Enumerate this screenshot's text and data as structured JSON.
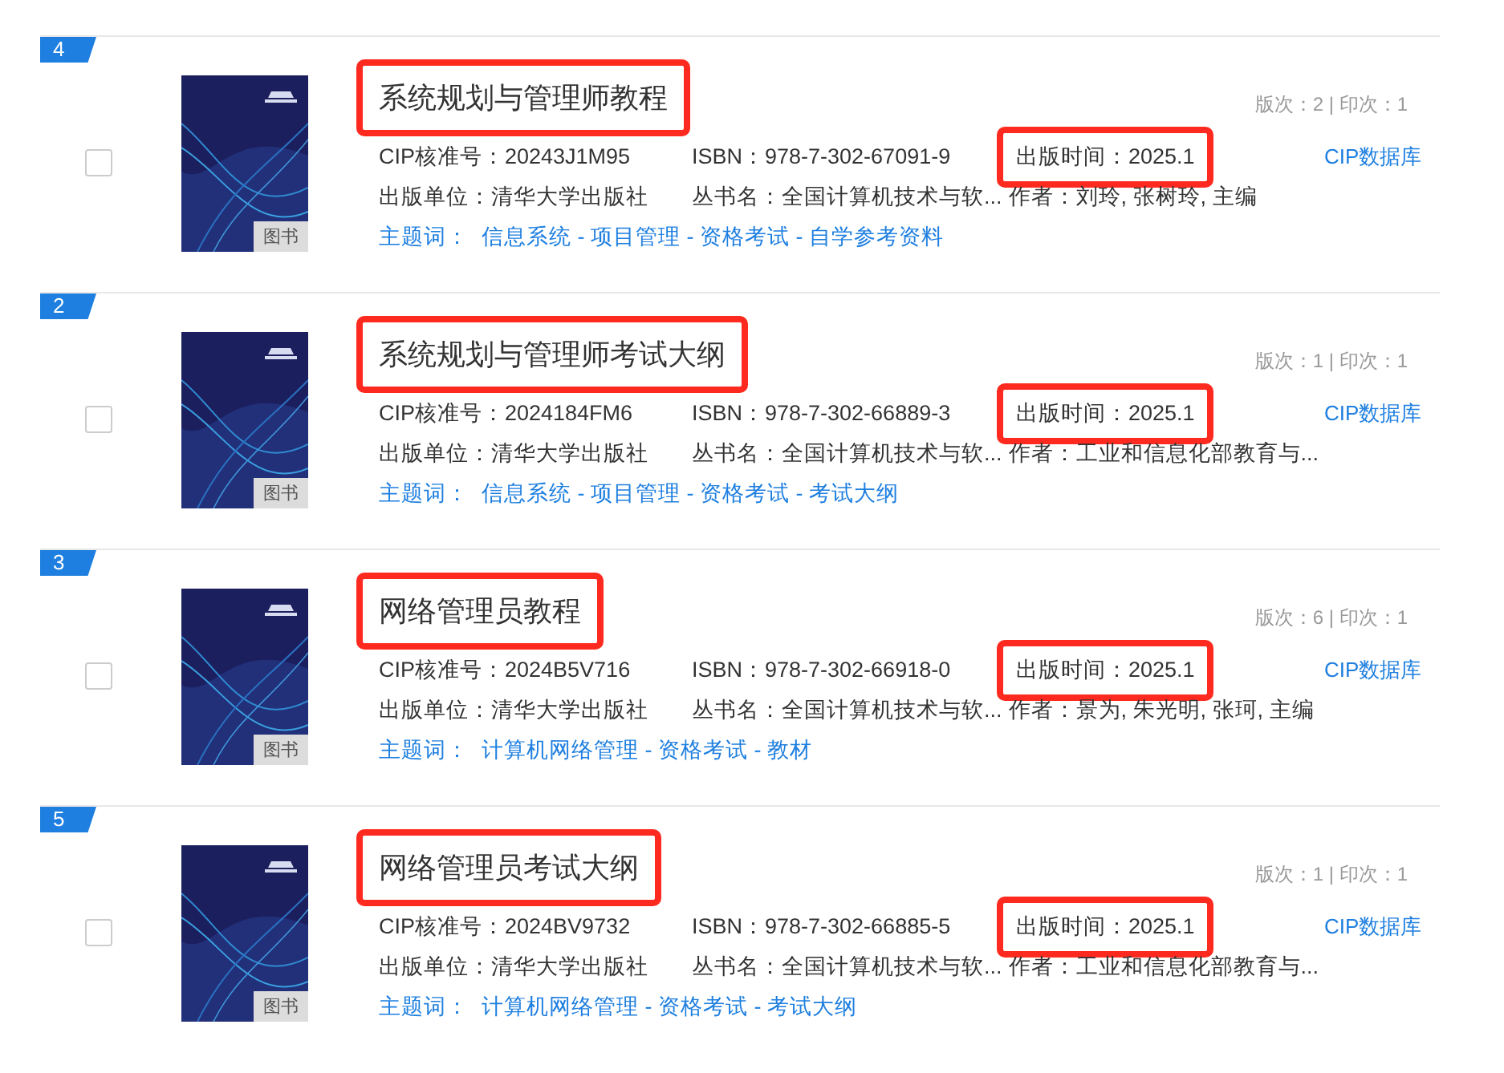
{
  "results": [
    {
      "rank": "4",
      "checked": false,
      "badge": "图书",
      "title": {
        "text": "系统规划与管理师教程",
        "highlighted": true
      },
      "edition": "版次：2 | 印次：1",
      "cip": "CIP核准号：20243J1M95",
      "isbn": "ISBN：978-7-302-67091-9",
      "pub_date": {
        "text": "出版时间：2025.1",
        "highlighted": true
      },
      "database_link": "CIP数据库",
      "publisher": "出版单位：清华大学出版社",
      "series": "丛书名：全国计算机技术与软...",
      "author": "作者：刘玲, 张树玲, 主编",
      "subject_label": "主题词：",
      "subjects": "信息系统 - 项目管理 - 资格考试 - 自学参考资料"
    },
    {
      "rank": "2",
      "checked": false,
      "badge": "图书",
      "title": {
        "text": "系统规划与管理师考试大纲",
        "highlighted": true
      },
      "edition": "版次：1 | 印次：1",
      "cip": "CIP核准号：2024184FM6",
      "isbn": "ISBN：978-7-302-66889-3",
      "pub_date": {
        "text": "出版时间：2025.1",
        "highlighted": true
      },
      "database_link": "CIP数据库",
      "publisher": "出版单位：清华大学出版社",
      "series": "丛书名：全国计算机技术与软...",
      "author": "作者：工业和信息化部教育与...",
      "subject_label": "主题词：",
      "subjects": "信息系统 - 项目管理 - 资格考试 - 考试大纲"
    },
    {
      "rank": "3",
      "checked": false,
      "badge": "图书",
      "title": {
        "text": "网络管理员教程",
        "highlighted": true
      },
      "edition": "版次：6 | 印次：1",
      "cip": "CIP核准号：2024B5V716",
      "isbn": "ISBN：978-7-302-66918-0",
      "pub_date": {
        "text": "出版时间：2025.1",
        "highlighted": true
      },
      "database_link": "CIP数据库",
      "publisher": "出版单位：清华大学出版社",
      "series": "丛书名：全国计算机技术与软...",
      "author": "作者：景为, 朱光明, 张珂, 主编",
      "subject_label": "主题词：",
      "subjects": "计算机网络管理 - 资格考试 - 教材"
    },
    {
      "rank": "5",
      "checked": false,
      "badge": "图书",
      "title": {
        "text": "网络管理员考试大纲",
        "highlighted": true
      },
      "edition": "版次：1 | 印次：1",
      "cip": "CIP核准号：2024BV9732",
      "isbn": "ISBN：978-7-302-66885-5",
      "pub_date": {
        "text": "出版时间：2025.1",
        "highlighted": true
      },
      "database_link": "CIP数据库",
      "publisher": "出版单位：清华大学出版社",
      "series": "丛书名：全国计算机技术与软...",
      "author": "作者：工业和信息化部教育与...",
      "subject_label": "主题词：",
      "subjects": "计算机网络管理 - 资格考试 - 考试大纲"
    }
  ]
}
